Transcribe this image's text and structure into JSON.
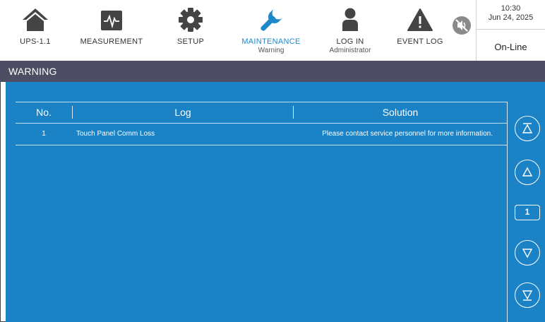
{
  "nav": {
    "ups": {
      "label": "UPS-1.1",
      "icon": "home-icon"
    },
    "measurement": {
      "label": "MEASUREMENT",
      "icon": "waveform-icon"
    },
    "setup": {
      "label": "SETUP",
      "icon": "gear-icon"
    },
    "maintenance": {
      "label": "MAINTENANCE",
      "sub": "Warning",
      "icon": "wrench-icon"
    },
    "login": {
      "label": "LOG IN",
      "sub": "Administrator",
      "icon": "user-icon"
    },
    "eventlog": {
      "label": "EVENT LOG",
      "icon": "warning-icon"
    },
    "mute": {
      "icon": "mute-icon"
    }
  },
  "status": {
    "time": "10:30",
    "date": "Jun 24, 2025",
    "mode": "On-Line"
  },
  "page_title": "WARNING",
  "table": {
    "headers": {
      "no": "No.",
      "log": "Log",
      "solution": "Solution"
    },
    "rows": [
      {
        "no": "1",
        "log": "Touch Panel Comm Loss",
        "solution": "Please contact service personnel for more information."
      }
    ]
  },
  "pager": {
    "page": "1"
  },
  "colors": {
    "accent": "#1f88c8",
    "content_bg": "#1a82c5",
    "titlebar": "#4d4d63"
  }
}
